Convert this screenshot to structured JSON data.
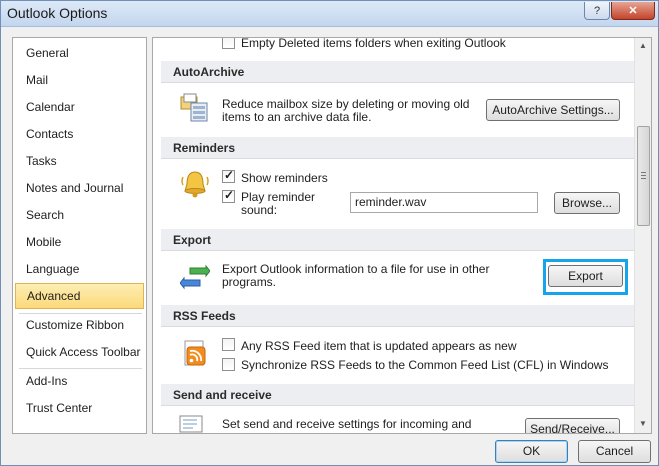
{
  "window": {
    "title": "Outlook Options"
  },
  "nav": {
    "items": [
      {
        "label": "General"
      },
      {
        "label": "Mail"
      },
      {
        "label": "Calendar"
      },
      {
        "label": "Contacts"
      },
      {
        "label": "Tasks"
      },
      {
        "label": "Notes and Journal"
      },
      {
        "label": "Search"
      },
      {
        "label": "Mobile"
      },
      {
        "label": "Language"
      },
      {
        "label": "Advanced",
        "selected": true
      },
      {
        "label": "Customize Ribbon"
      },
      {
        "label": "Quick Access Toolbar"
      },
      {
        "label": "Add-Ins"
      },
      {
        "label": "Trust Center"
      }
    ]
  },
  "content": {
    "top_partial": {
      "label": "Empty Deleted items folders when exiting Outlook"
    },
    "autoarchive": {
      "heading": "AutoArchive",
      "desc_line1": "Reduce mailbox size by deleting or moving old",
      "desc_line2": "items to an archive data file.",
      "button": "AutoArchive Settings...",
      "icon": "archive-icon"
    },
    "reminders": {
      "heading": "Reminders",
      "show_label": "Show reminders",
      "show_checked": true,
      "play_label_line1": "Play reminder",
      "play_label_line2": "sound:",
      "play_checked": true,
      "sound_file": "reminder.wav",
      "browse_button": "Browse...",
      "icon": "bell-icon"
    },
    "export": {
      "heading": "Export",
      "desc_line1": "Export Outlook information to a file for use in other",
      "desc_line2": "programs.",
      "button": "Export",
      "icon": "export-arrows-icon"
    },
    "rss": {
      "heading": "RSS Feeds",
      "item1": "Any RSS Feed item that is updated appears as new",
      "item1_checked": false,
      "item2": "Synchronize RSS Feeds to the Common Feed List (CFL) in Windows",
      "item2_checked": false,
      "icon": "rss-icon"
    },
    "send_receive": {
      "heading": "Send and receive",
      "desc_line1": "Set send and receive settings for incoming and",
      "button": "Send/Receive...",
      "icon": "send-receive-icon"
    }
  },
  "footer": {
    "ok": "OK",
    "cancel": "Cancel"
  },
  "colors": {
    "focus_ring": "#16a4ea",
    "selected_nav": "#fbd97a"
  }
}
